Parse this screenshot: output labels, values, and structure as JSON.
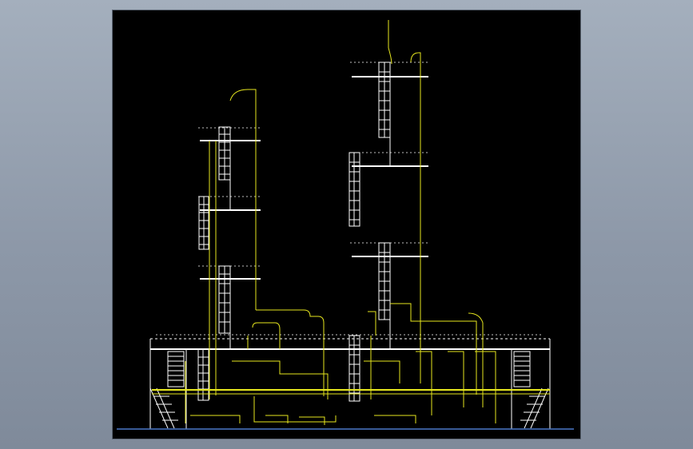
{
  "viewer": {
    "background_color": "#97a2b2",
    "canvas_color": "#000000"
  },
  "drawing": {
    "stroke_colors": {
      "structure": "#ffffff",
      "pipe": "#e6e61e",
      "ground": "#4a78c8"
    },
    "icons": [
      "ladder",
      "cage-ladder",
      "stair",
      "platform",
      "pipe-route"
    ]
  }
}
